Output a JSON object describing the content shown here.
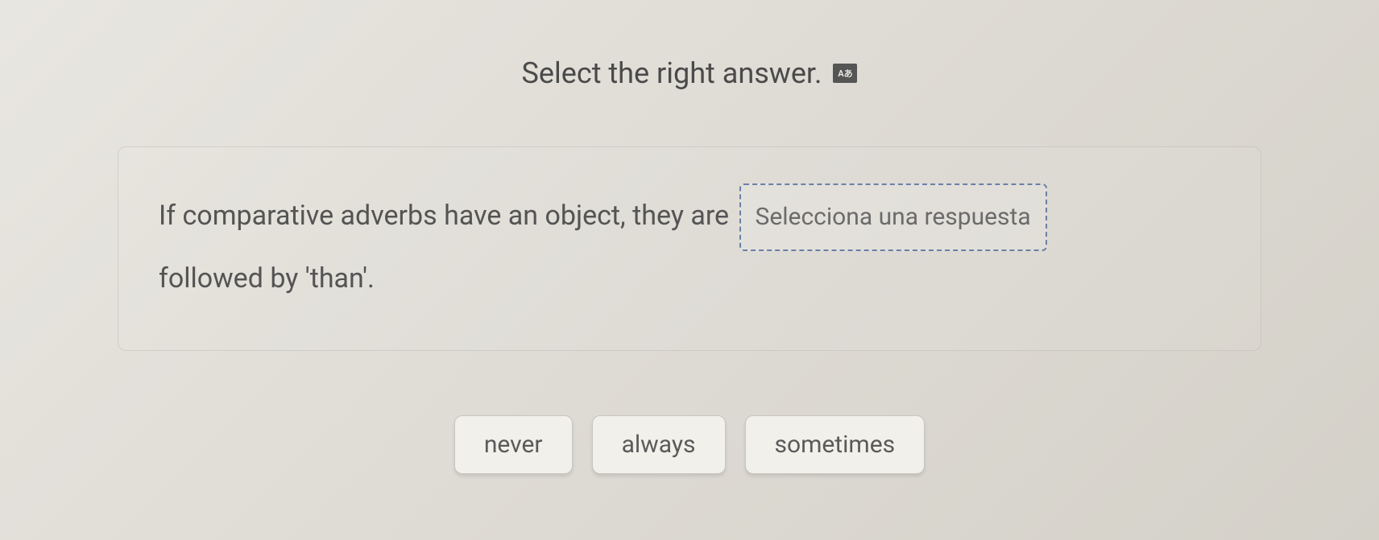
{
  "header": {
    "title": "Select the right answer.",
    "icon_label": "Aあ"
  },
  "question": {
    "part1": "If comparative adverbs have an object, they are",
    "dropzone_placeholder": "Selecciona una respuesta",
    "part2": "followed by 'than'."
  },
  "options": [
    {
      "label": "never"
    },
    {
      "label": "always"
    },
    {
      "label": "sometimes"
    }
  ],
  "page_counter": ""
}
